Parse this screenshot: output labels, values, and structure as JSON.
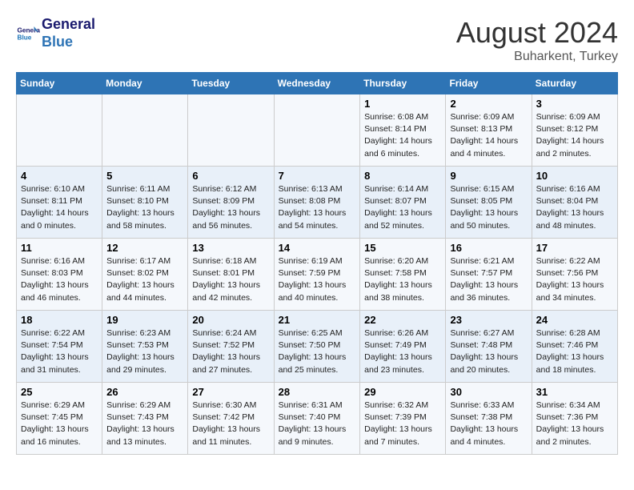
{
  "header": {
    "logo_line1": "General",
    "logo_line2": "Blue",
    "month_year": "August 2024",
    "location": "Buharkent, Turkey"
  },
  "weekdays": [
    "Sunday",
    "Monday",
    "Tuesday",
    "Wednesday",
    "Thursday",
    "Friday",
    "Saturday"
  ],
  "weeks": [
    [
      {
        "day": "",
        "info": ""
      },
      {
        "day": "",
        "info": ""
      },
      {
        "day": "",
        "info": ""
      },
      {
        "day": "",
        "info": ""
      },
      {
        "day": "1",
        "info": "Sunrise: 6:08 AM\nSunset: 8:14 PM\nDaylight: 14 hours\nand 6 minutes."
      },
      {
        "day": "2",
        "info": "Sunrise: 6:09 AM\nSunset: 8:13 PM\nDaylight: 14 hours\nand 4 minutes."
      },
      {
        "day": "3",
        "info": "Sunrise: 6:09 AM\nSunset: 8:12 PM\nDaylight: 14 hours\nand 2 minutes."
      }
    ],
    [
      {
        "day": "4",
        "info": "Sunrise: 6:10 AM\nSunset: 8:11 PM\nDaylight: 14 hours\nand 0 minutes."
      },
      {
        "day": "5",
        "info": "Sunrise: 6:11 AM\nSunset: 8:10 PM\nDaylight: 13 hours\nand 58 minutes."
      },
      {
        "day": "6",
        "info": "Sunrise: 6:12 AM\nSunset: 8:09 PM\nDaylight: 13 hours\nand 56 minutes."
      },
      {
        "day": "7",
        "info": "Sunrise: 6:13 AM\nSunset: 8:08 PM\nDaylight: 13 hours\nand 54 minutes."
      },
      {
        "day": "8",
        "info": "Sunrise: 6:14 AM\nSunset: 8:07 PM\nDaylight: 13 hours\nand 52 minutes."
      },
      {
        "day": "9",
        "info": "Sunrise: 6:15 AM\nSunset: 8:05 PM\nDaylight: 13 hours\nand 50 minutes."
      },
      {
        "day": "10",
        "info": "Sunrise: 6:16 AM\nSunset: 8:04 PM\nDaylight: 13 hours\nand 48 minutes."
      }
    ],
    [
      {
        "day": "11",
        "info": "Sunrise: 6:16 AM\nSunset: 8:03 PM\nDaylight: 13 hours\nand 46 minutes."
      },
      {
        "day": "12",
        "info": "Sunrise: 6:17 AM\nSunset: 8:02 PM\nDaylight: 13 hours\nand 44 minutes."
      },
      {
        "day": "13",
        "info": "Sunrise: 6:18 AM\nSunset: 8:01 PM\nDaylight: 13 hours\nand 42 minutes."
      },
      {
        "day": "14",
        "info": "Sunrise: 6:19 AM\nSunset: 7:59 PM\nDaylight: 13 hours\nand 40 minutes."
      },
      {
        "day": "15",
        "info": "Sunrise: 6:20 AM\nSunset: 7:58 PM\nDaylight: 13 hours\nand 38 minutes."
      },
      {
        "day": "16",
        "info": "Sunrise: 6:21 AM\nSunset: 7:57 PM\nDaylight: 13 hours\nand 36 minutes."
      },
      {
        "day": "17",
        "info": "Sunrise: 6:22 AM\nSunset: 7:56 PM\nDaylight: 13 hours\nand 34 minutes."
      }
    ],
    [
      {
        "day": "18",
        "info": "Sunrise: 6:22 AM\nSunset: 7:54 PM\nDaylight: 13 hours\nand 31 minutes."
      },
      {
        "day": "19",
        "info": "Sunrise: 6:23 AM\nSunset: 7:53 PM\nDaylight: 13 hours\nand 29 minutes."
      },
      {
        "day": "20",
        "info": "Sunrise: 6:24 AM\nSunset: 7:52 PM\nDaylight: 13 hours\nand 27 minutes."
      },
      {
        "day": "21",
        "info": "Sunrise: 6:25 AM\nSunset: 7:50 PM\nDaylight: 13 hours\nand 25 minutes."
      },
      {
        "day": "22",
        "info": "Sunrise: 6:26 AM\nSunset: 7:49 PM\nDaylight: 13 hours\nand 23 minutes."
      },
      {
        "day": "23",
        "info": "Sunrise: 6:27 AM\nSunset: 7:48 PM\nDaylight: 13 hours\nand 20 minutes."
      },
      {
        "day": "24",
        "info": "Sunrise: 6:28 AM\nSunset: 7:46 PM\nDaylight: 13 hours\nand 18 minutes."
      }
    ],
    [
      {
        "day": "25",
        "info": "Sunrise: 6:29 AM\nSunset: 7:45 PM\nDaylight: 13 hours\nand 16 minutes."
      },
      {
        "day": "26",
        "info": "Sunrise: 6:29 AM\nSunset: 7:43 PM\nDaylight: 13 hours\nand 13 minutes."
      },
      {
        "day": "27",
        "info": "Sunrise: 6:30 AM\nSunset: 7:42 PM\nDaylight: 13 hours\nand 11 minutes."
      },
      {
        "day": "28",
        "info": "Sunrise: 6:31 AM\nSunset: 7:40 PM\nDaylight: 13 hours\nand 9 minutes."
      },
      {
        "day": "29",
        "info": "Sunrise: 6:32 AM\nSunset: 7:39 PM\nDaylight: 13 hours\nand 7 minutes."
      },
      {
        "day": "30",
        "info": "Sunrise: 6:33 AM\nSunset: 7:38 PM\nDaylight: 13 hours\nand 4 minutes."
      },
      {
        "day": "31",
        "info": "Sunrise: 6:34 AM\nSunset: 7:36 PM\nDaylight: 13 hours\nand 2 minutes."
      }
    ]
  ]
}
